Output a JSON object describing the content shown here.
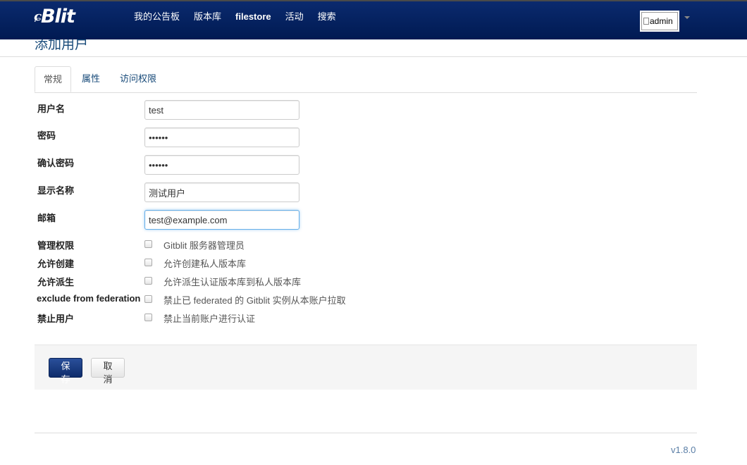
{
  "brand": {
    "mark": "ɕ",
    "name": "Blit"
  },
  "nav": [
    "我的公告板",
    "版本库",
    "filestore",
    "活动",
    "搜索"
  ],
  "user": {
    "alt": "admin"
  },
  "page": {
    "title": "添加用户"
  },
  "tabs": [
    "常规",
    "属性",
    "访问权限"
  ],
  "form": {
    "username": {
      "label": "用户名",
      "value": "test"
    },
    "password": {
      "label": "密码",
      "value": "••••••"
    },
    "confirm_password": {
      "label": "确认密码",
      "value": "••••••"
    },
    "display_name": {
      "label": "显示名称",
      "value": "测试用户"
    },
    "email": {
      "label": "邮箱",
      "value": "test@example.com"
    },
    "checkboxes": [
      {
        "label": "管理权限",
        "text": "Gitblit 服务器管理员",
        "checked": false
      },
      {
        "label": "允许创建",
        "text": "允许创建私人版本库",
        "checked": false
      },
      {
        "label": "允许派生",
        "text": "允许派生认证版本库到私人版本库",
        "checked": false
      },
      {
        "label": "exclude from federation",
        "text": "禁止已 federated 的 Gitblit 实例从本账户拉取",
        "checked": false
      },
      {
        "label": "禁止用户",
        "text": "禁止当前账户进行认证",
        "checked": false
      }
    ]
  },
  "actions": {
    "save": "保存",
    "cancel": "取消"
  },
  "footer": {
    "version": "v1.8.0"
  }
}
